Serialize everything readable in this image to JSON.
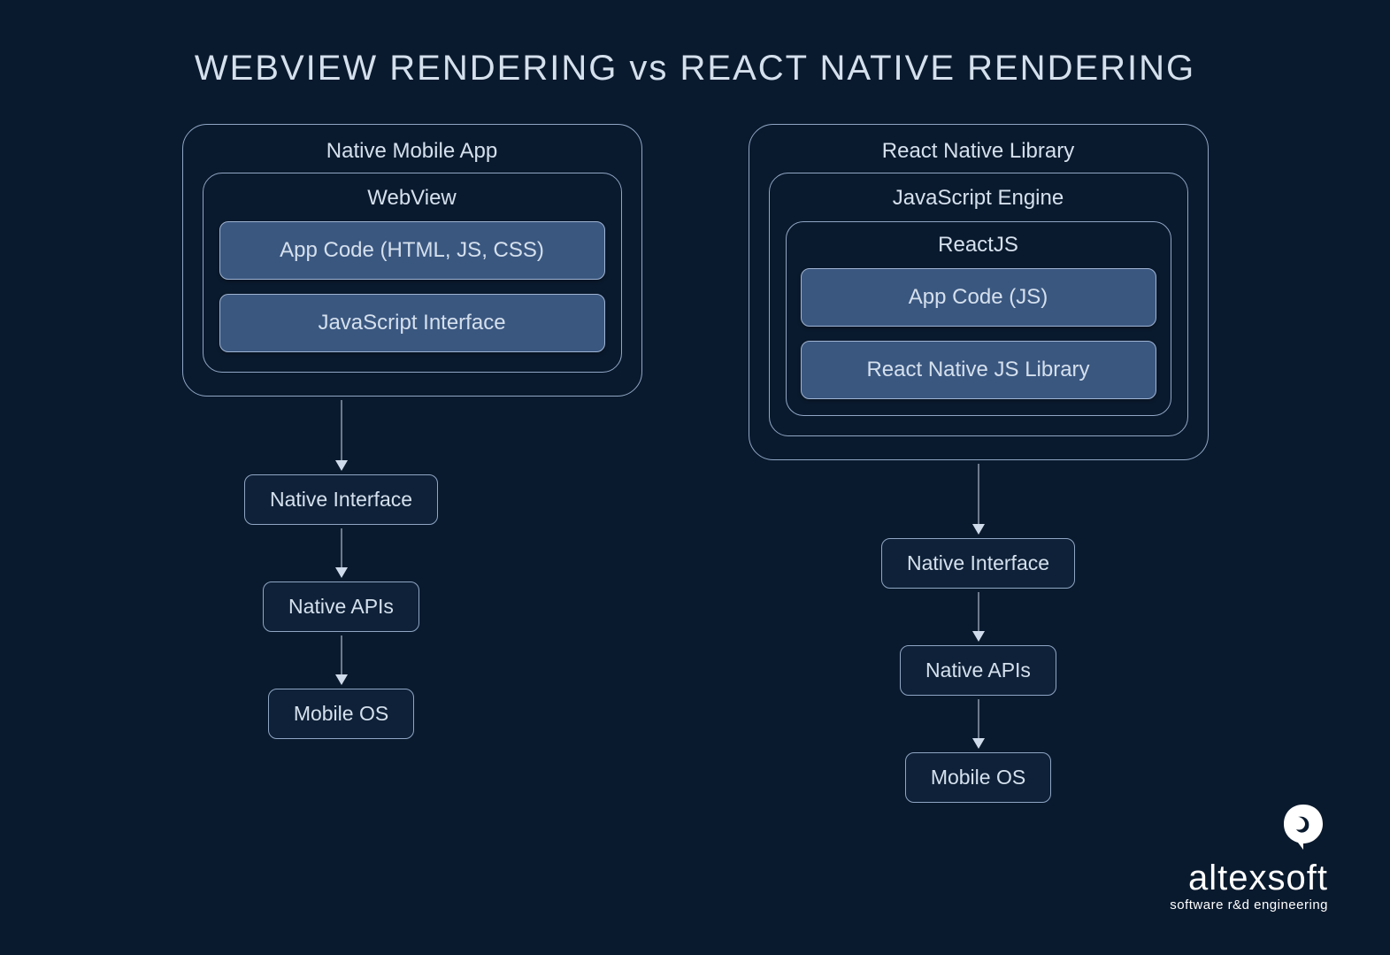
{
  "title": "WEBVIEW RENDERING vs REACT NATIVE RENDERING",
  "left": {
    "outer": "Native Mobile App",
    "inner": "WebView",
    "fill1": "App Code (HTML, JS, CSS)",
    "fill2": "JavaScript Interface",
    "step1": "Native Interface",
    "step2": "Native APIs",
    "step3": "Mobile OS"
  },
  "right": {
    "outer": "React Native Library",
    "inner": "JavaScript Engine",
    "inner2": "ReactJS",
    "fill1": "App Code (JS)",
    "fill2": "React Native JS Library",
    "step1": "Native Interface",
    "step2": "Native APIs",
    "step3": "Mobile OS"
  },
  "logo": {
    "brand": "altexsoft",
    "tag": "software r&d engineering"
  }
}
